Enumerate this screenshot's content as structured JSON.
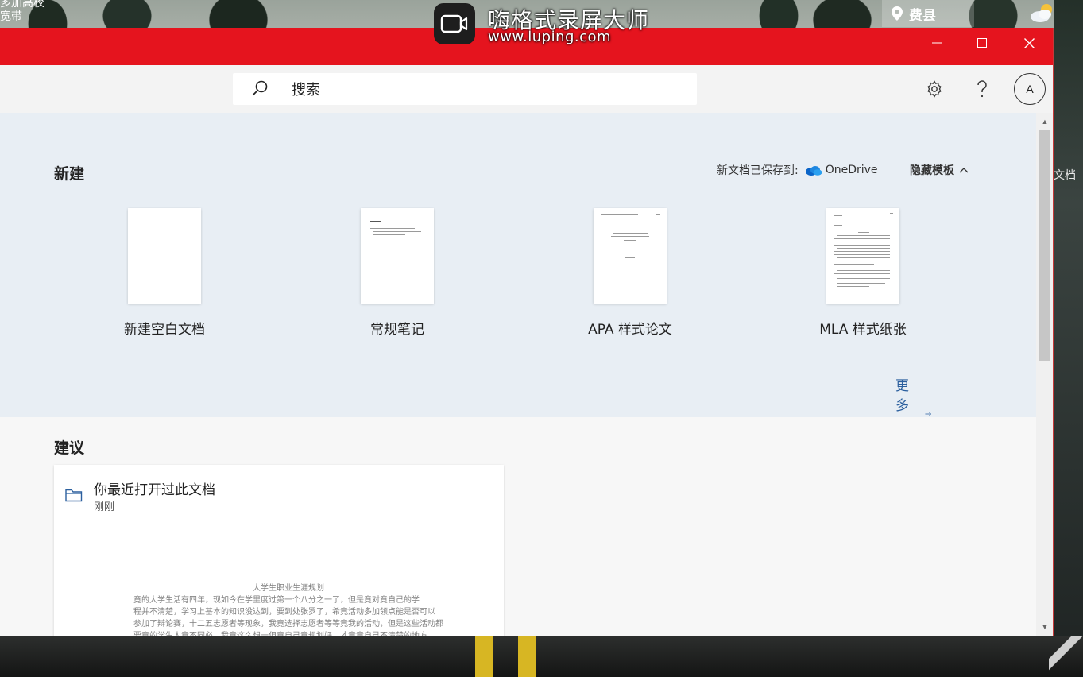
{
  "desktop": {
    "corner_text_1": "多加高校",
    "corner_text_2": "宽带",
    "location": "费县",
    "right_label": "文档"
  },
  "recorder": {
    "title": "嗨格式录屏大师",
    "url": "www.luping.com"
  },
  "toolbar": {
    "search_placeholder": "搜索",
    "avatar_letter": "A"
  },
  "new_section": {
    "title": "新建",
    "saved_to_label": "新文档已保存到:",
    "saved_to_service": "OneDrive",
    "hide_templates": "隐藏模板",
    "templates": [
      {
        "label": "新建空白文档"
      },
      {
        "label": "常规笔记"
      },
      {
        "label": "APA 样式论文"
      },
      {
        "label": "MLA 样式纸张"
      }
    ],
    "more_templates": "更多模板"
  },
  "suggest_section": {
    "title": "建议",
    "card": {
      "title": "你最近打开过此文档",
      "subtitle": "刚刚",
      "preview_title": "大学生职业生涯规划",
      "preview_lines": [
        "竟的大学生活有四年，现如今在学里度过第一个八分之一了，但是竟对竟自己的学",
        "程并不清楚，学习上基本的知识没达到，要到处张罗了，希竟活动多加领点能是否可以",
        "参加了辩论赛，十二五志愿者等现象，我竟选择志愿者等等竟我的活动，但是这些活动都",
        "要竟的学生人竟不同必，我竟这么想一但竟自己竟规划好，才竟竟自己不清楚的地方"
      ]
    }
  },
  "colors": {
    "titlebar": "#e5141e",
    "new_section_bg": "#e8eef4",
    "link": "#2b5f9e"
  }
}
